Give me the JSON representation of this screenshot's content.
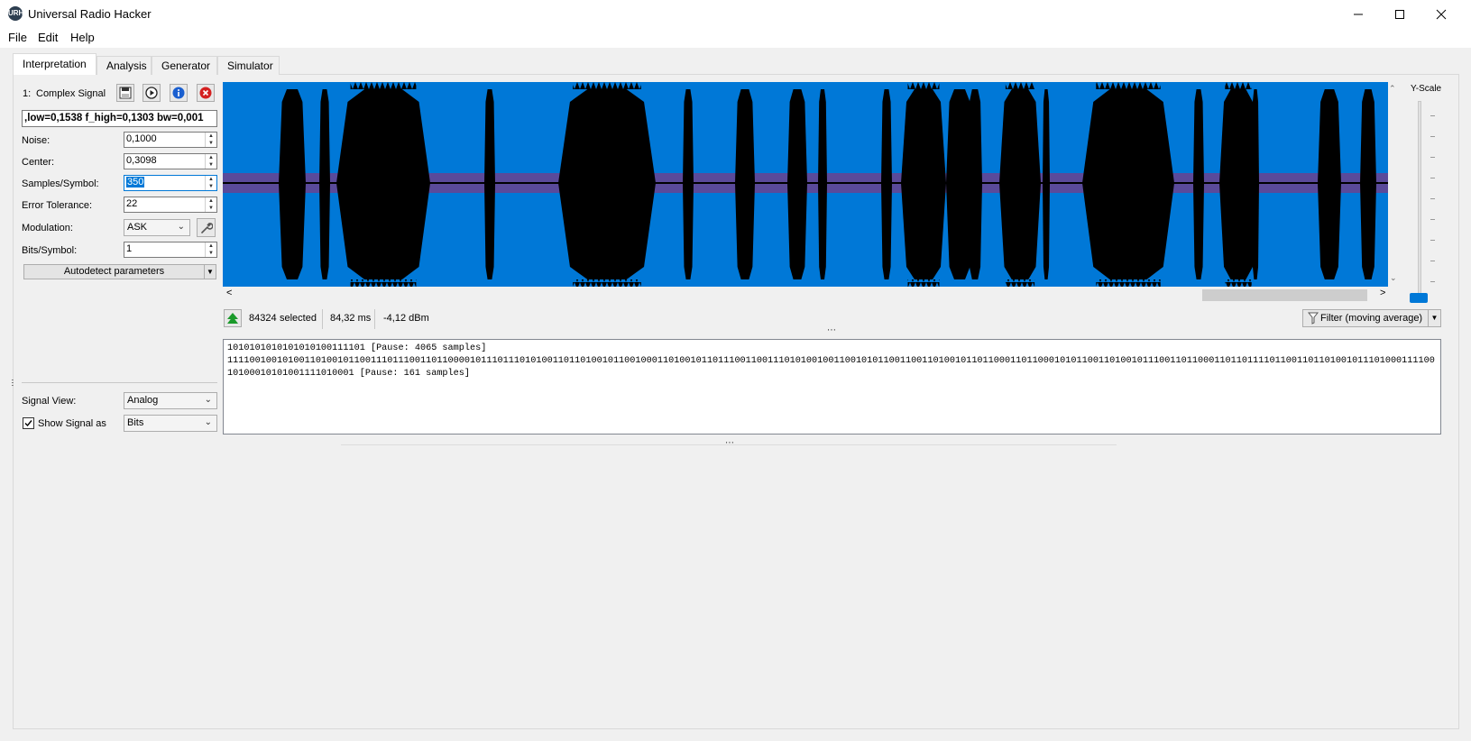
{
  "window": {
    "title": "Universal Radio Hacker",
    "icon_text": "URH"
  },
  "menu": {
    "file": "File",
    "edit": "Edit",
    "help": "Help"
  },
  "tabs": [
    "Interpretation",
    "Analysis",
    "Generator",
    "Simulator"
  ],
  "signal": {
    "number": "1:",
    "name": "Complex Signal",
    "filter_string": ",low=0,1538 f_high=0,1303 bw=0,001"
  },
  "params": {
    "noise_label": "Noise:",
    "noise_value": "0,1000",
    "center_label": "Center:",
    "center_value": "0,3098",
    "samples_label": "Samples/Symbol:",
    "samples_value": "350",
    "error_label": "Error Tolerance:",
    "error_value": "22",
    "modulation_label": "Modulation:",
    "modulation_value": "ASK",
    "bits_label": "Bits/Symbol:",
    "bits_value": "1",
    "autodetect_label": "Autodetect parameters"
  },
  "view": {
    "signal_view_label": "Signal View:",
    "signal_view_value": "Analog",
    "show_signal_label": "Show Signal as",
    "show_signal_checked": true,
    "show_signal_value": "Bits"
  },
  "yscale": {
    "label": "Y-Scale"
  },
  "status": {
    "selected_count": "84324",
    "selected_label": "selected",
    "duration": "84,32 ms",
    "power": "-4,12 dBm",
    "filter_label": "Filter (moving average)"
  },
  "protocol": {
    "lines": [
      "1010101010101010100111101 [Pause: 4065 samples]",
      "11110010010100110100101100111011100110110000101110111010100110110100101100100011010010110111001100111010100100110010101100110011010010110110001101100010101100110100101110011011000110110111101100110110100101110100011110010100010101001111010001 [Pause: 161 samples]"
    ]
  },
  "colors": {
    "accent": "#0078d7",
    "noise_band": "#5a4a9a",
    "waveform": "#000000"
  }
}
